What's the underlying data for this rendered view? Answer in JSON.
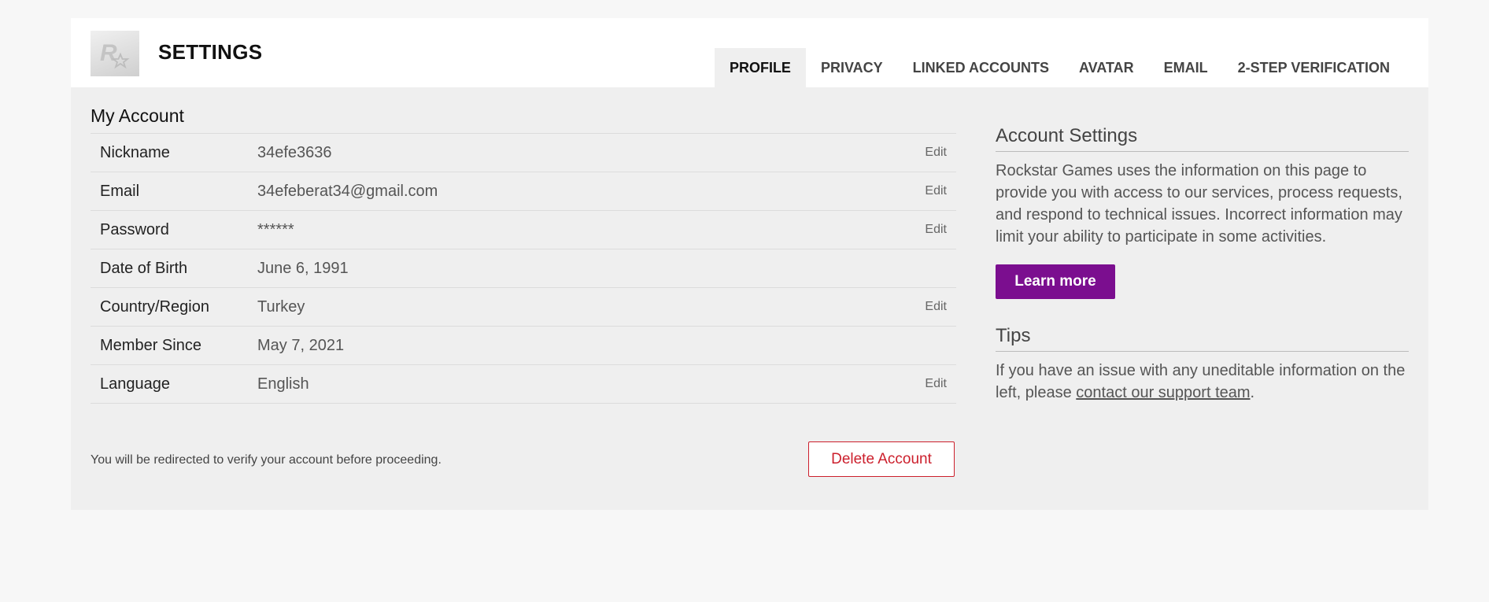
{
  "header": {
    "title": "SETTINGS",
    "logo_icon": "rockstar-logo-icon",
    "tabs": [
      {
        "label": "PROFILE",
        "active": true
      },
      {
        "label": "PRIVACY",
        "active": false
      },
      {
        "label": "LINKED ACCOUNTS",
        "active": false
      },
      {
        "label": "AVATAR",
        "active": false
      },
      {
        "label": "EMAIL",
        "active": false
      },
      {
        "label": "2-STEP VERIFICATION",
        "active": false
      }
    ]
  },
  "account": {
    "title": "My Account",
    "edit_label": "Edit",
    "rows": [
      {
        "label": "Nickname",
        "value": "34efe3636",
        "editable": true
      },
      {
        "label": "Email",
        "value": "34efeberat34@gmail.com",
        "editable": true
      },
      {
        "label": "Password",
        "value": "******",
        "editable": true
      },
      {
        "label": "Date of Birth",
        "value": "June 6, 1991",
        "editable": false
      },
      {
        "label": "Country/Region",
        "value": "Turkey",
        "editable": true
      },
      {
        "label": "Member Since",
        "value": "May 7, 2021",
        "editable": false
      },
      {
        "label": "Language",
        "value": "English",
        "editable": true
      }
    ]
  },
  "footer": {
    "note": "You will be redirected to verify your account before proceeding.",
    "delete_label": "Delete Account"
  },
  "sidebar": {
    "settings_title": "Account Settings",
    "settings_text": "Rockstar Games uses the information on this page to provide you with access to our services, process requests, and respond to technical issues. Incorrect information may limit your ability to participate in some activities.",
    "learn_more_label": "Learn more",
    "tips_title": "Tips",
    "tips_text_before": "If you have an issue with any uneditable information on the left, please ",
    "tips_link": "contact our support team",
    "tips_text_after": "."
  },
  "colors": {
    "accent_purple": "#7b0e8f",
    "danger_red": "#cc1f2c",
    "page_bg": "#f7f7f7",
    "card_bg": "#efefef"
  }
}
